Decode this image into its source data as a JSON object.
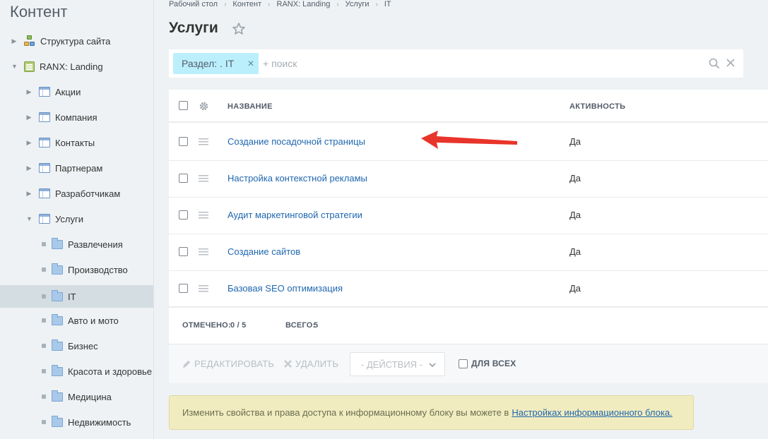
{
  "sidebar": {
    "title": "Контент",
    "items": [
      {
        "label": "Структура сайта",
        "icon": "structure-icon"
      },
      {
        "label": "RANX: Landing",
        "icon": "landing-icon"
      },
      {
        "label": "Акции",
        "icon": "table-icon"
      },
      {
        "label": "Компания",
        "icon": "table-icon"
      },
      {
        "label": "Контакты",
        "icon": "table-icon"
      },
      {
        "label": "Партнерам",
        "icon": "table-icon"
      },
      {
        "label": "Разработчикам",
        "icon": "table-icon"
      },
      {
        "label": "Услуги",
        "icon": "table-icon"
      },
      {
        "label": "Развлечения",
        "icon": "folder-icon"
      },
      {
        "label": "Производство",
        "icon": "folder-icon"
      },
      {
        "label": "IT",
        "icon": "folder-icon",
        "active": true
      },
      {
        "label": "Авто и мото",
        "icon": "folder-icon"
      },
      {
        "label": "Бизнес",
        "icon": "folder-icon"
      },
      {
        "label": "Красота и здоровье",
        "icon": "folder-icon"
      },
      {
        "label": "Медицина",
        "icon": "folder-icon"
      },
      {
        "label": "Недвижимость",
        "icon": "folder-icon"
      }
    ]
  },
  "breadcrumb": [
    "Рабочий стол",
    "Контент",
    "RANX: Landing",
    "Услуги",
    "IT"
  ],
  "page": {
    "title": "Услуги"
  },
  "filter": {
    "chip_label": "Раздел: . IT",
    "placeholder": "+ поиск"
  },
  "grid": {
    "col_name": "НАЗВАНИЕ",
    "col_active": "АКТИВНОСТЬ",
    "rows": [
      {
        "name": "Создание посадочной страницы",
        "active": "Да"
      },
      {
        "name": "Настройка контекстной рекламы",
        "active": "Да"
      },
      {
        "name": "Аудит маркетинговой стратегии",
        "active": "Да"
      },
      {
        "name": "Создание сайтов",
        "active": "Да"
      },
      {
        "name": "Базовая SEO оптимизация",
        "active": "Да"
      }
    ],
    "selected_label": "ОТМЕЧЕНО:",
    "selected_value": "0 / 5",
    "total_label": "ВСЕГО:",
    "total_value": "5"
  },
  "actions": {
    "edit": "РЕДАКТИРОВАТЬ",
    "delete": "УДАЛИТЬ",
    "select": "- ДЕЙСТВИЯ -",
    "forall": "ДЛЯ ВСЕХ"
  },
  "notice": {
    "text": "Изменить свойства и права доступа к информационному блоку вы можете в",
    "link": "Настройках информационного блока."
  },
  "colors": {
    "accent_link": "#2067b0",
    "chip_bg": "#bbeffc",
    "annotation_arrow": "#e8342a",
    "notice_bg": "#f1ecc0"
  }
}
